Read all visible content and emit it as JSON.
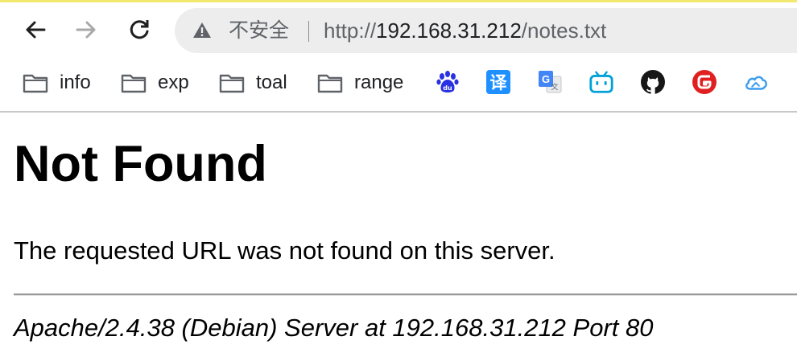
{
  "toolbar": {
    "back_icon": "back-arrow-icon",
    "forward_icon": "forward-arrow-icon",
    "reload_icon": "reload-icon"
  },
  "omnibox": {
    "security_icon": "warning-triangle-icon",
    "security_label": "不安全",
    "url_scheme": "http://",
    "url_host": "192.168.31.212",
    "url_path": "/notes.txt"
  },
  "bookmarks": {
    "folders": [
      {
        "label": "info"
      },
      {
        "label": "exp"
      },
      {
        "label": "toal"
      },
      {
        "label": "range"
      }
    ],
    "icons": [
      {
        "name": "baidu-icon",
        "color": "#2932e1"
      },
      {
        "name": "translate-icon",
        "glyph": "译",
        "color": "#1e90ff"
      },
      {
        "name": "google-translate-icon",
        "glyph": "G",
        "color": "#4285f4"
      },
      {
        "name": "bilibili-icon",
        "color": "#00a1d6"
      },
      {
        "name": "github-icon",
        "color": "#181717"
      },
      {
        "name": "gitee-icon",
        "color": "#e02020"
      },
      {
        "name": "cloud-icon",
        "color": "#3b9cf0"
      }
    ]
  },
  "page": {
    "title": "Not Found",
    "message": "The requested URL was not found on this server.",
    "address": "Apache/2.4.38 (Debian) Server at 192.168.31.212 Port 80"
  },
  "colors": {
    "accent_topline": "#f2e96f",
    "omnibox_bg": "#ededed",
    "secondary_text": "#5f6368"
  }
}
